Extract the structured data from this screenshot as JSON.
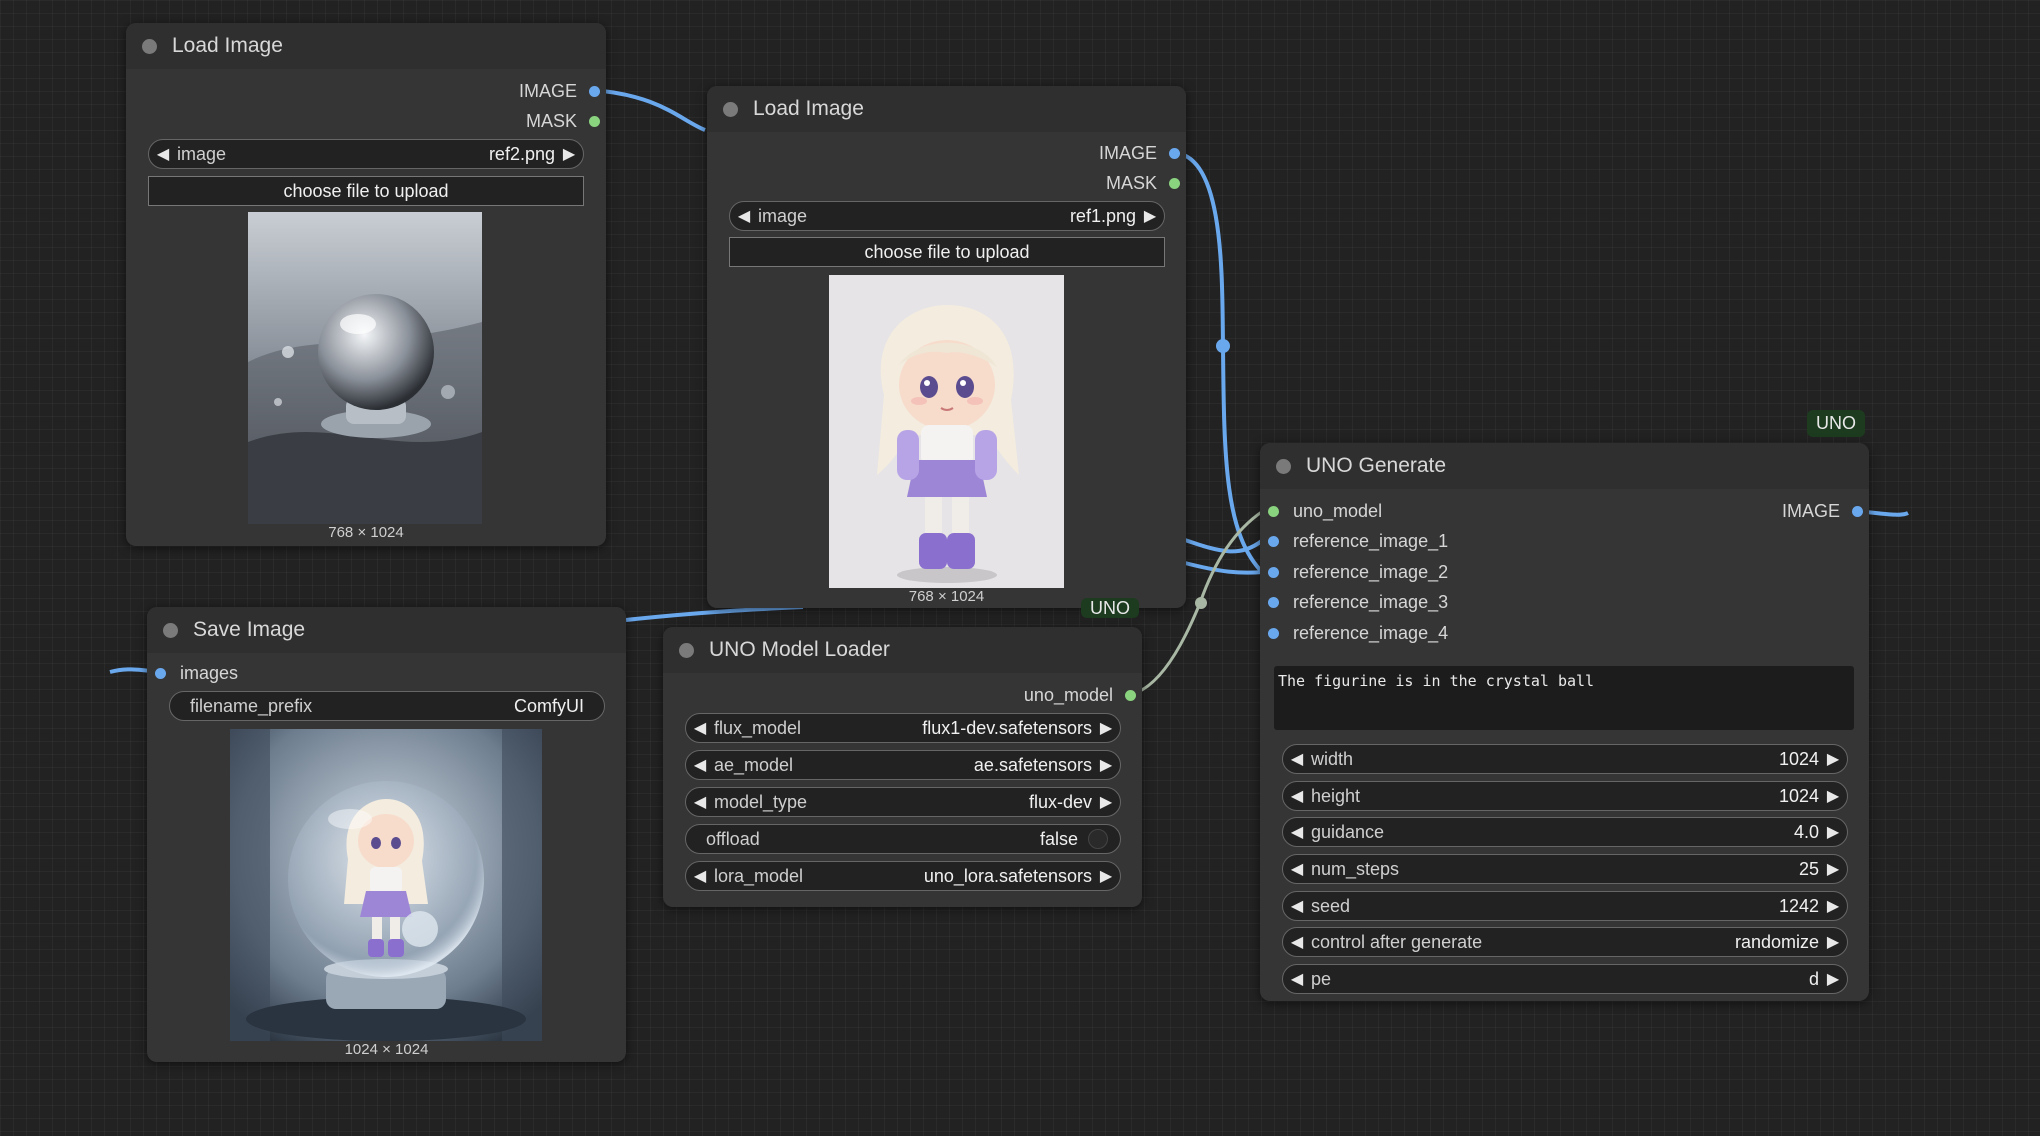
{
  "nodes": {
    "load_image_2": {
      "title": "Load Image",
      "outputs": [
        "IMAGE",
        "MASK"
      ],
      "image_widget": {
        "label": "image",
        "value": "ref2.png"
      },
      "upload_label": "choose file to upload",
      "preview_caption": "768 × 1024"
    },
    "load_image_1": {
      "title": "Load Image",
      "outputs": [
        "IMAGE",
        "MASK"
      ],
      "image_widget": {
        "label": "image",
        "value": "ref1.png"
      },
      "upload_label": "choose file to upload",
      "preview_caption": "768 × 1024"
    },
    "save_image": {
      "title": "Save Image",
      "inputs": [
        "images"
      ],
      "filename_prefix": {
        "label": "filename_prefix",
        "value": "ComfyUI"
      },
      "preview_caption": "1024 × 1024"
    },
    "uno_model_loader": {
      "title": "UNO Model Loader",
      "badge": "UNO",
      "outputs": [
        "uno_model"
      ],
      "widgets": [
        {
          "label": "flux_model",
          "value": "flux1-dev.safetensors"
        },
        {
          "label": "ae_model",
          "value": "ae.safetensors"
        },
        {
          "label": "model_type",
          "value": "flux-dev"
        },
        {
          "label": "offload",
          "value": "false"
        },
        {
          "label": "lora_model",
          "value": "uno_lora.safetensors"
        }
      ]
    },
    "uno_generate": {
      "title": "UNO Generate",
      "badge": "UNO",
      "inputs": [
        "uno_model",
        "reference_image_1",
        "reference_image_2",
        "reference_image_3",
        "reference_image_4"
      ],
      "outputs": [
        "IMAGE"
      ],
      "prompt": "The figurine is in the crystal ball",
      "widgets": [
        {
          "label": "width",
          "value": "1024"
        },
        {
          "label": "height",
          "value": "1024"
        },
        {
          "label": "guidance",
          "value": "4.0"
        },
        {
          "label": "num_steps",
          "value": "25"
        },
        {
          "label": "seed",
          "value": "1242"
        },
        {
          "label": "control after generate",
          "value": "randomize"
        },
        {
          "label": "pe",
          "value": "d"
        }
      ]
    }
  },
  "colors": {
    "image_link": "#6aa8ee",
    "model_link": "#a9b8a4",
    "badge_bg": "#1d3b1f"
  }
}
